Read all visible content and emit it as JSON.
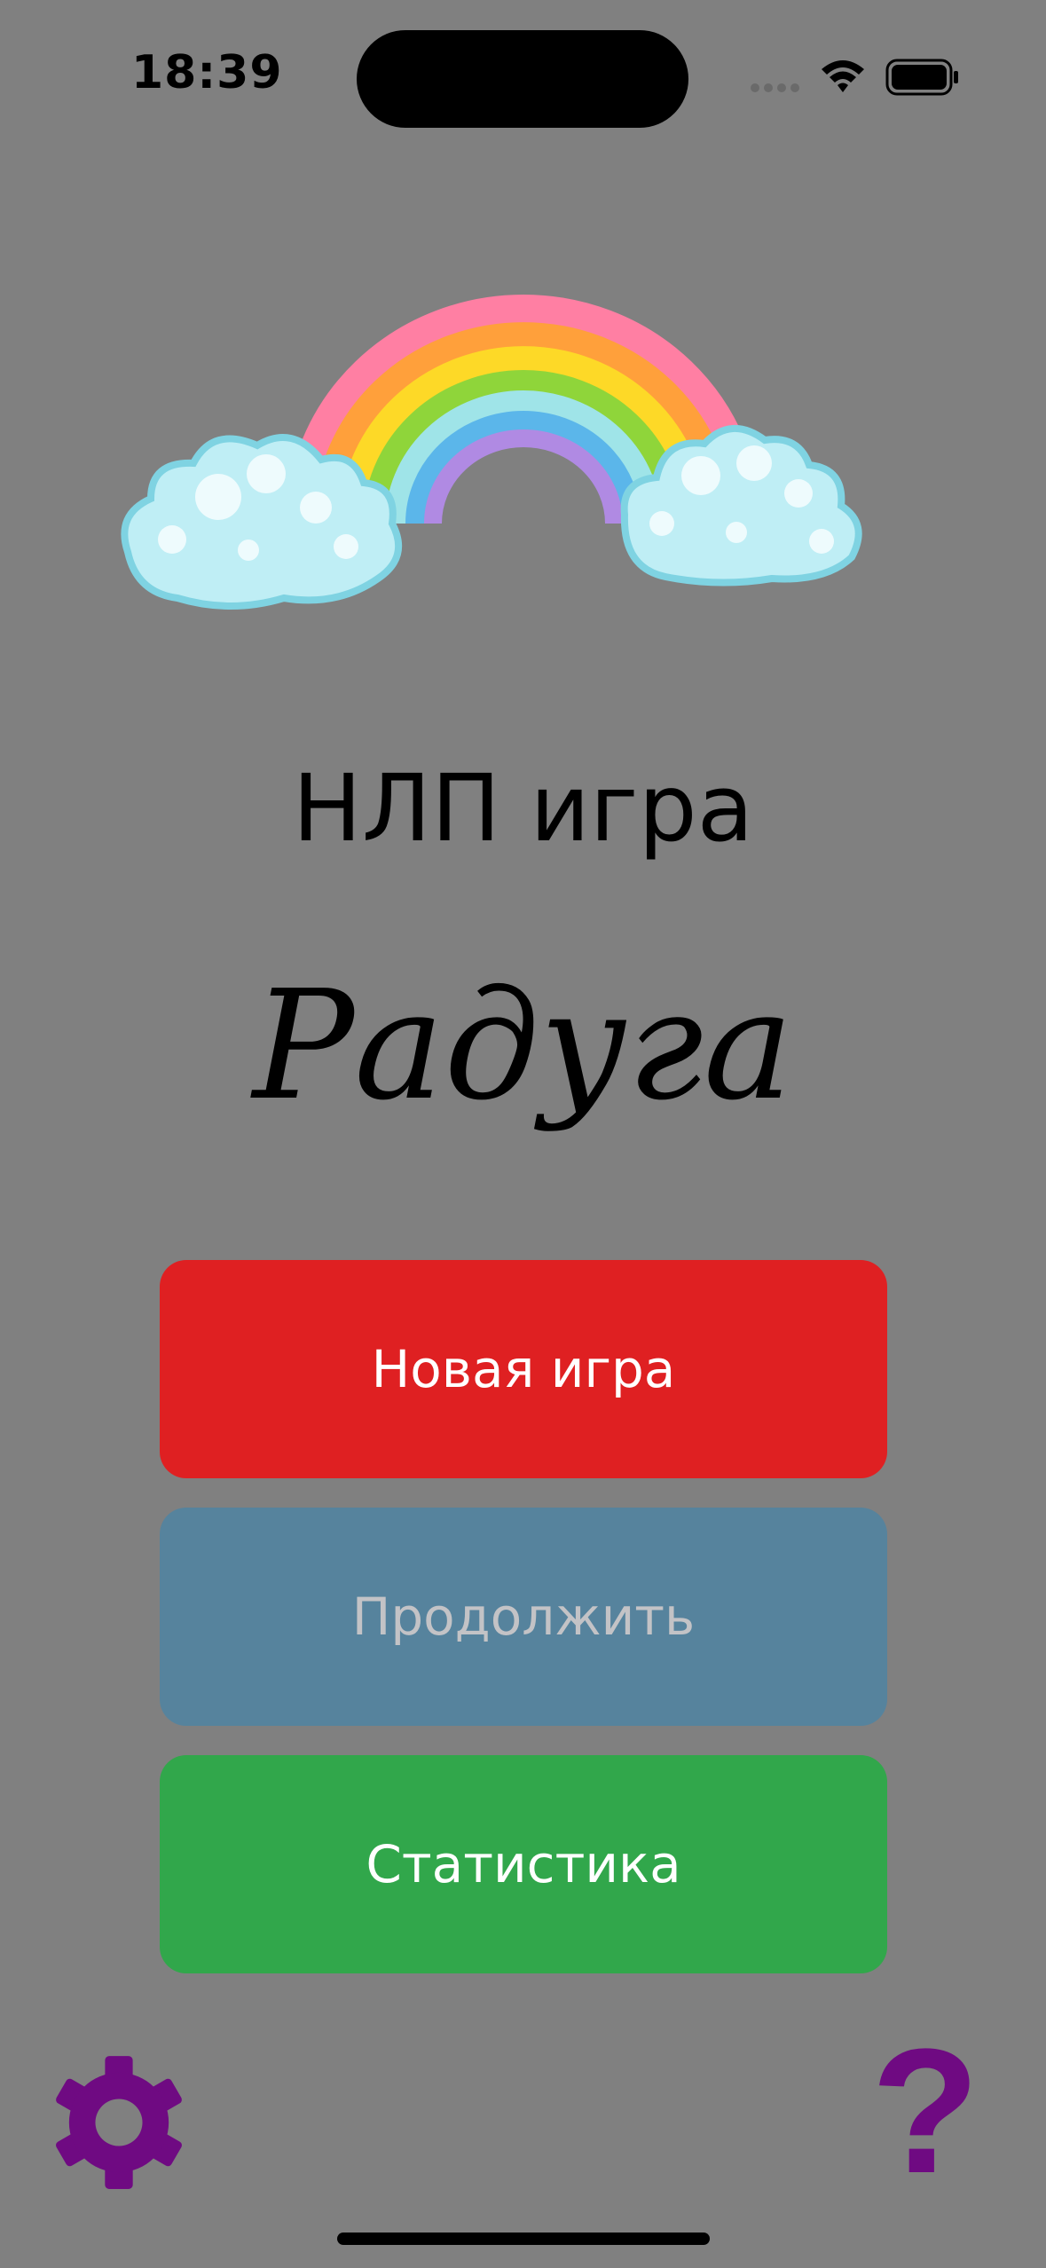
{
  "status_bar": {
    "time": "18:39",
    "icons": [
      "cellular-signal-icon",
      "wifi-icon",
      "battery-icon"
    ]
  },
  "hero": {
    "image": "rainbow-with-clouds",
    "subtitle": "НЛП игра",
    "title": "Радуга"
  },
  "menu": {
    "new_game": "Новая игра",
    "continue": "Продолжить",
    "statistics": "Статистика"
  },
  "bottom_bar": {
    "settings_icon": "gear-icon",
    "help": "?"
  },
  "colors": {
    "background": "#808080",
    "new_game": "#df2022",
    "continue": "#56839d",
    "statistics": "#31a74b",
    "accent_purple": "#6f0a82"
  }
}
